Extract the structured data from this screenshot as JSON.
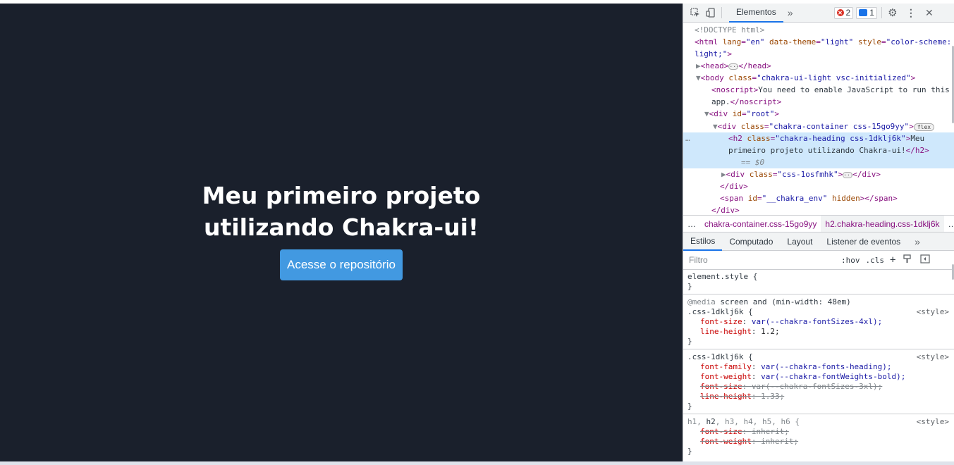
{
  "page": {
    "heading": "Meu primeiro projeto utilizando Chakra-ui!",
    "button_label": "Acesse o repositório",
    "bg_color": "#1a202c",
    "button_color": "#4299e1"
  },
  "devtools": {
    "tab_elements": "Elementos",
    "more_tabs": "»",
    "error_count": "2",
    "message_count": "1",
    "tree": {
      "doctype": "<!DOCTYPE html>",
      "html_open": "<html",
      "html_attr1": "lang",
      "html_val1": "\"en\"",
      "html_attr2": "data-theme",
      "html_val2": "\"light\"",
      "html_attr3": "style",
      "html_val3": "\"color-scheme:",
      "html_val3b": "light;\"",
      "html_close": ">",
      "head": "<head>",
      "head_close": "</head>",
      "body_open": "<body",
      "body_attr": "class",
      "body_val": "\"chakra-ui-light vsc-initialized\"",
      "noscript_open": "<noscript>",
      "noscript_text1": "You need to enable JavaScript to run this",
      "noscript_text2": "app.",
      "noscript_close": "</noscript>",
      "root_open": "<div",
      "root_attr": "id",
      "root_val": "\"root\"",
      "container_attr": "class",
      "container_val": "\"chakra-container css-15go9yy\"",
      "flex_badge": "flex",
      "h2_open": "<h2",
      "h2_attr": "class",
      "h2_val": "\"chakra-heading css-1dklj6k\"",
      "h2_text1": "Meu",
      "h2_text2": "primeiro projeto utilizando Chakra-ui!",
      "h2_close": "</h2>",
      "dollar0": "== $0",
      "inner_attr": "class",
      "inner_val": "\"css-1osfmhk\"",
      "div_close": "</div>",
      "span_open": "<span",
      "span_attr": "id",
      "span_val": "\"__chakra_env\"",
      "span_attr2": "hidden",
      "span_close": "</span>",
      "sel_gutter": "…"
    },
    "breadcrumb": {
      "ellipsis": "…",
      "item1": "chakra-container.css-15go9yy",
      "item2": "h2.chakra-heading.css-1dklj6k",
      "item3": "…"
    },
    "style_tabs": [
      "Estilos",
      "Computado",
      "Layout",
      "Listener de eventos",
      "»"
    ],
    "filter": {
      "placeholder": "Filtro",
      "hov": ":hov",
      "cls": ".cls",
      "plus": "+"
    },
    "rules": {
      "r1_selector": "element.style {",
      "r1_close": "}",
      "r2_media_kw": "@media",
      "r2_media": "screen and (min-width: 48em)",
      "r2_selector": ".css-1dklj6k {",
      "r2_src": "<style>",
      "r2_p1_name": "font-size",
      "r2_p1_val": "var(--chakra-fontSizes-4xl);",
      "r2_p2_name": "line-height",
      "r2_p2_val": "1.2;",
      "r2_close": "}",
      "r3_selector": ".css-1dklj6k {",
      "r3_src": "<style>",
      "r3_p1_name": "font-family",
      "r3_p1_val": "var(--chakra-fonts-heading);",
      "r3_p2_name": "font-weight",
      "r3_p2_val": "var(--chakra-fontWeights-bold);",
      "r3_p3_name": "font-size",
      "r3_p3_val": "var(--chakra-fontSizes-3xl);",
      "r3_p4_name": "line-height",
      "r3_p4_val": "1.33;",
      "r3_close": "}",
      "r4_selector_pre": "h1, ",
      "r4_selector_match": "h2",
      "r4_selector_post": ", h3, h4, h5, h6 {",
      "r4_src": "<style>",
      "r4_p1_name": "font-size",
      "r4_p1_val": "inherit;",
      "r4_p2_name": "font-weight",
      "r4_p2_val": "inherit;",
      "r4_close": "}"
    }
  }
}
